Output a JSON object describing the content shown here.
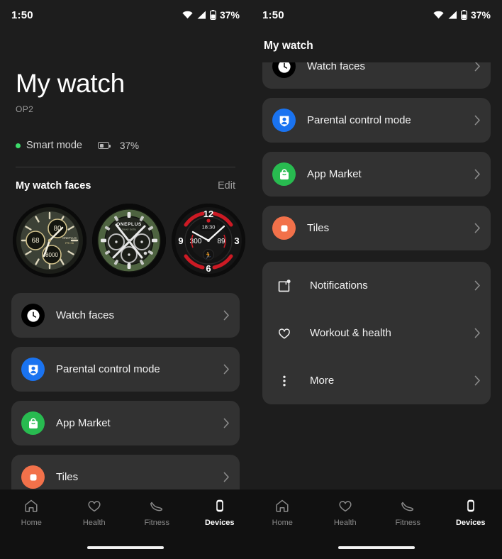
{
  "statusbar": {
    "time": "1:50",
    "battery_pct": "37%",
    "icons": [
      "wifi-icon",
      "cellular-signal-icon",
      "battery-icon"
    ]
  },
  "left_screen": {
    "hero": {
      "title": "My watch",
      "model": "OP2",
      "mode_label": "Smart mode",
      "mode_dot_color": "#3ddc6b",
      "battery_pct": "37%"
    },
    "watch_faces_section": {
      "title": "My watch faces",
      "edit_label": "Edit",
      "faces": [
        {
          "name": "olive-chrono-face",
          "dial_color": "#3c4136",
          "accent": "#cfc08a",
          "subdials": [
            "80",
            "68",
            "8000"
          ],
          "brand": "ONEPLUS",
          "date": "FRI 06"
        },
        {
          "name": "green-oneplus-chrono-face",
          "dial_color": "#2f3a28",
          "accent": "#c8c8c8",
          "brand": "ONEPLUS",
          "tagline": "Never Settle"
        },
        {
          "name": "red-sport-face",
          "dial_color": "#151515",
          "accent": "#cc1a24",
          "numerals": [
            "12",
            "3",
            "6",
            "9"
          ],
          "time_label": "18:30",
          "left_value": "300",
          "right_value": "89"
        }
      ]
    },
    "menu": [
      {
        "label": "Watch faces",
        "icon": "clock-icon",
        "icon_bg": "#000000",
        "grouped": false
      },
      {
        "label": "Parental control mode",
        "icon": "person-shield-icon",
        "icon_bg": "#1a73f0",
        "grouped": false
      },
      {
        "label": "App Market",
        "icon": "shopping-bag-icon",
        "icon_bg": "#28bb50",
        "grouped": false
      },
      {
        "label": "Tiles",
        "icon": "tiles-icon",
        "icon_bg": "#f2714a",
        "grouped": false
      }
    ]
  },
  "right_screen": {
    "header_title": "My watch",
    "menu": [
      {
        "label": "Watch faces",
        "icon": "clock-icon",
        "icon_bg": "#000000",
        "grouped": false
      },
      {
        "label": "Parental control mode",
        "icon": "person-shield-icon",
        "icon_bg": "#1a73f0",
        "grouped": false
      },
      {
        "label": "App Market",
        "icon": "shopping-bag-icon",
        "icon_bg": "#28bb50",
        "grouped": false
      },
      {
        "label": "Tiles",
        "icon": "tiles-icon",
        "icon_bg": "#f2714a",
        "grouped": false
      }
    ],
    "grouped_menu": [
      {
        "label": "Notifications",
        "icon": "notification-square-icon"
      },
      {
        "label": "Workout & health",
        "icon": "heart-icon"
      },
      {
        "label": "More",
        "icon": "more-vertical-icon"
      }
    ]
  },
  "bottom_nav": {
    "items": [
      {
        "label": "Home",
        "icon": "home-icon",
        "active": false
      },
      {
        "label": "Health",
        "icon": "heart-icon",
        "active": false
      },
      {
        "label": "Fitness",
        "icon": "shoe-icon",
        "active": false
      },
      {
        "label": "Devices",
        "icon": "watch-icon",
        "active": true
      }
    ]
  }
}
